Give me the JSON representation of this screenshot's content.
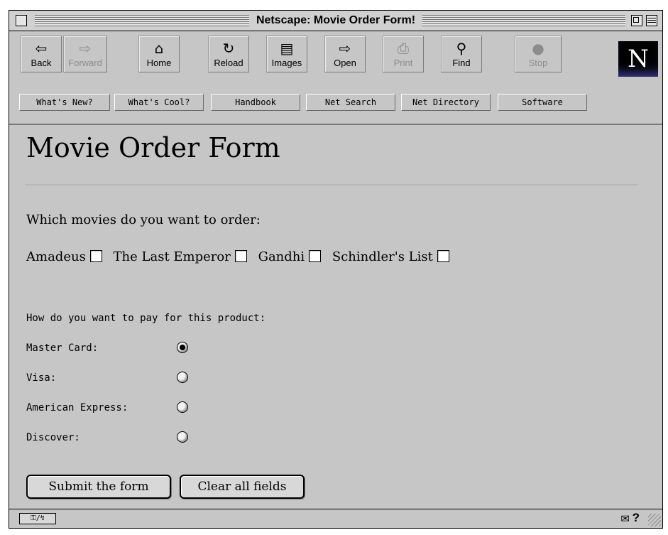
{
  "window": {
    "title": "Netscape: Movie Order Form!"
  },
  "toolbar": {
    "buttons": [
      {
        "label": "Back",
        "icon": "⇦",
        "enabled": true
      },
      {
        "label": "Forward",
        "icon": "⇨",
        "enabled": false
      },
      {
        "label": "Home",
        "icon": "⌂",
        "enabled": true
      },
      {
        "label": "Reload",
        "icon": "↻",
        "enabled": true
      },
      {
        "label": "Images",
        "icon": "▤",
        "enabled": true
      },
      {
        "label": "Open",
        "icon": "⇨",
        "enabled": true
      },
      {
        "label": "Print",
        "icon": "⎙",
        "enabled": false
      },
      {
        "label": "Find",
        "icon": "⚲",
        "enabled": true
      },
      {
        "label": "Stop",
        "icon": "●",
        "enabled": false
      }
    ],
    "logo_letter": "N"
  },
  "directory": {
    "buttons": [
      "What's New?",
      "What's Cool?",
      "Handbook",
      "Net Search",
      "Net Directory",
      "Software"
    ]
  },
  "page": {
    "title": "Movie Order Form",
    "movie_question": "Which movies do you want to order:",
    "movies": [
      "Amadeus",
      "The Last Emperor",
      "Gandhi",
      "Schindler's List"
    ],
    "payment_question": "How do you want to pay for this product:",
    "payment_options": [
      "Master Card:",
      "Visa:",
      "American Express:",
      "Discover:"
    ],
    "selected_payment": "Master Card:",
    "submit_label": "Submit the form",
    "clear_label": "Clear all fields"
  },
  "statusbar": {
    "security_icon": "broken-key-icon",
    "mail_icon": "mail-icon",
    "help_icon": "?"
  }
}
